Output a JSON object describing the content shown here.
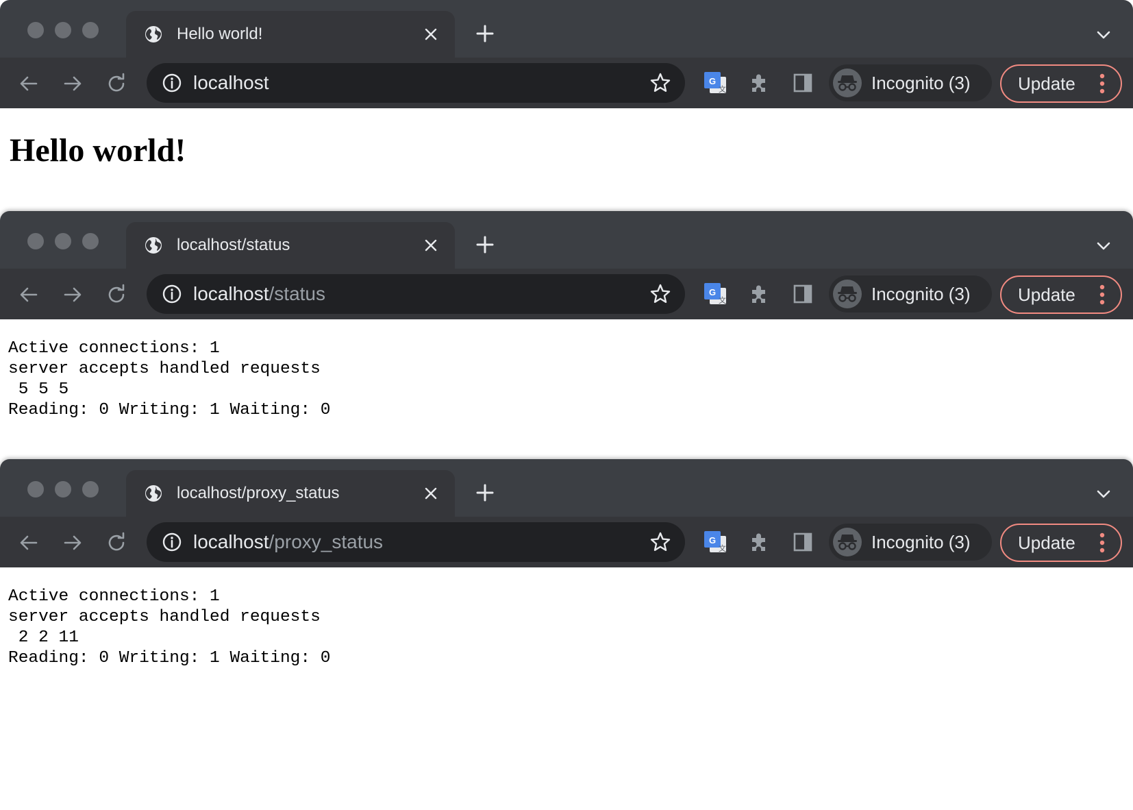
{
  "windows": [
    {
      "tab_title": "Hello world!",
      "url_host": "localhost",
      "url_path": "",
      "incognito_label": "Incognito (3)",
      "update_label": "Update",
      "page_heading": "Hello world!"
    },
    {
      "tab_title": "localhost/status",
      "url_host": "localhost",
      "url_path": "/status",
      "incognito_label": "Incognito (3)",
      "update_label": "Update",
      "status_text": "Active connections: 1\nserver accepts handled requests\n 5 5 5\nReading: 0 Writing: 1 Waiting: 0"
    },
    {
      "tab_title": "localhost/proxy_status",
      "url_host": "localhost",
      "url_path": "/proxy_status",
      "incognito_label": "Incognito (3)",
      "update_label": "Update",
      "status_text": "Active connections: 1\nserver accepts handled requests\n 2 2 11\nReading: 0 Writing: 1 Waiting: 0"
    }
  ],
  "icons": {
    "traffic_lights": "traffic-light-icons",
    "favicon": "globe-icon",
    "tab_close": "close-icon",
    "new_tab": "plus-icon",
    "tab_search": "chevron-down-icon",
    "back": "arrow-left-icon",
    "forward": "arrow-right-icon",
    "reload": "reload-icon",
    "site_info": "info-icon",
    "bookmark": "star-icon",
    "translate": "google-translate-icon",
    "extensions": "puzzle-icon",
    "side_panel": "side-panel-icon",
    "incognito": "incognito-icon",
    "menu": "kebab-menu-icon"
  },
  "colors": {
    "chrome_frame": "#3c3f44",
    "toolbar": "#35363a",
    "omnibox": "#202124",
    "update_border": "#f28b82",
    "text_light": "#e8eaed",
    "text_muted": "#9aa0a6"
  }
}
